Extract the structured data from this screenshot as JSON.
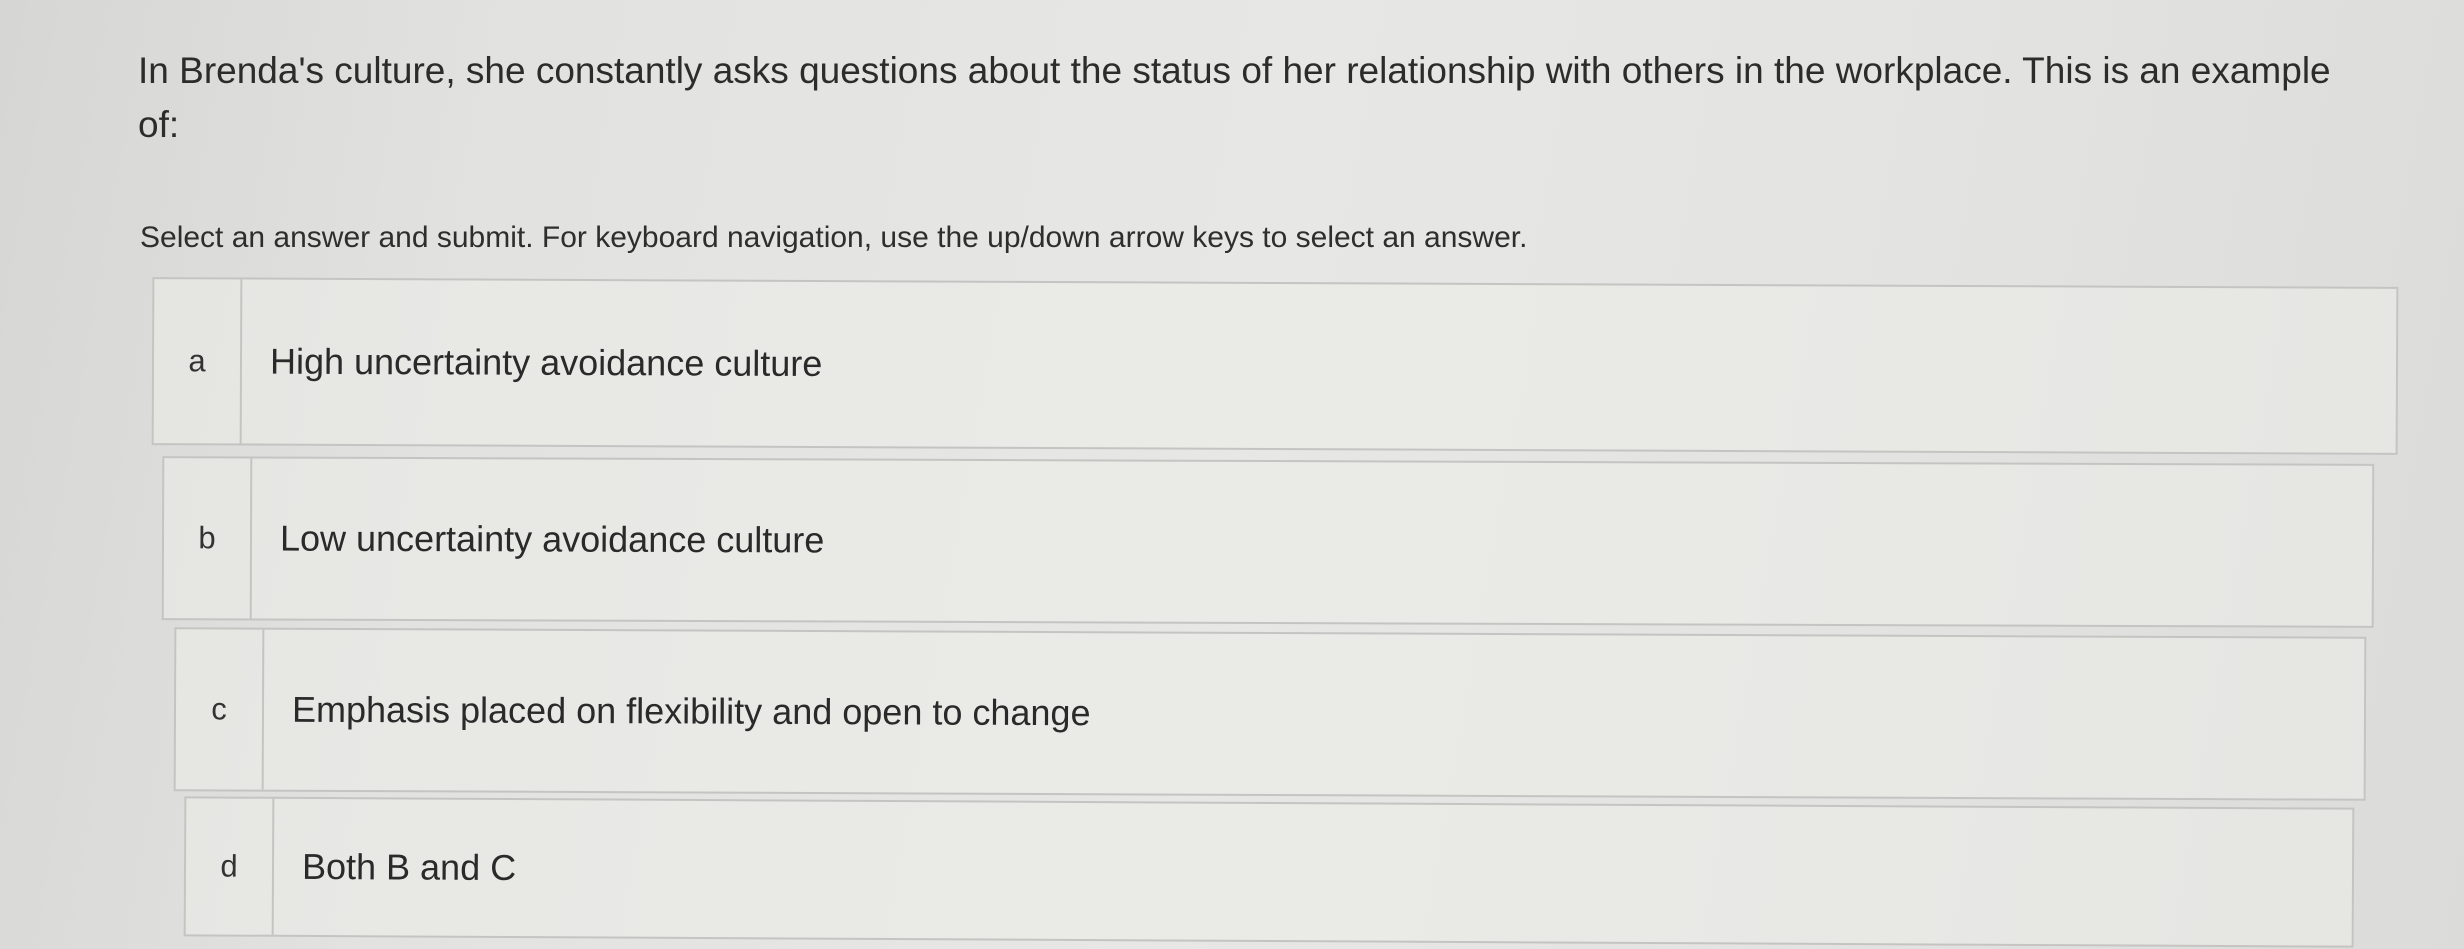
{
  "question": {
    "text": "In Brenda's culture, she constantly asks questions about the status of her relationship with others in the workplace. This is an example of:"
  },
  "instruction": "Select an answer and submit. For keyboard navigation, use the up/down arrow keys to select an answer.",
  "options": [
    {
      "letter": "a",
      "text": "High uncertainty avoidance culture"
    },
    {
      "letter": "b",
      "text": "Low uncertainty avoidance culture"
    },
    {
      "letter": "c",
      "text": "Emphasis placed on flexibility and open to change"
    },
    {
      "letter": "d",
      "text": "Both B and C"
    }
  ]
}
